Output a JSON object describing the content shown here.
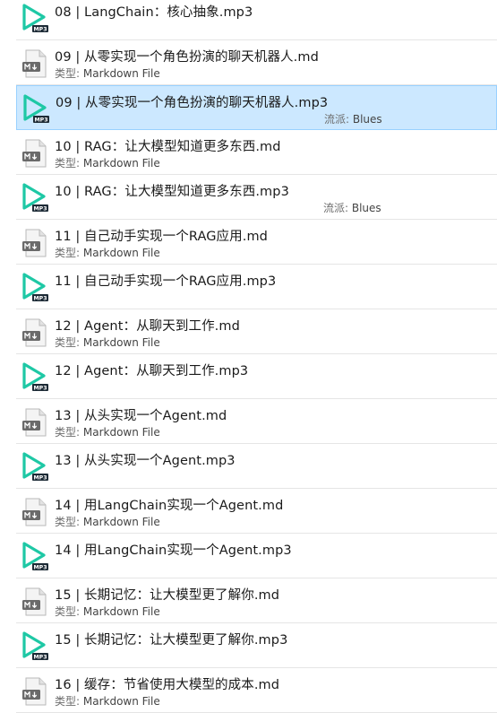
{
  "labels": {
    "type_prefix": "类型: ",
    "genre_prefix": "流派: "
  },
  "colors": {
    "mp3_play": "#1ec8a5",
    "selected_bg": "#cce8ff",
    "selected_border": "#99d1ff"
  },
  "files": [
    {
      "name": "08 | LangChain：核心抽象.mp3",
      "kind": "mp3",
      "icon": "mp3-play-icon",
      "type": "",
      "genre": ""
    },
    {
      "name": "09 | 从零实现一个角色扮演的聊天机器人.md",
      "kind": "md",
      "icon": "markdown-file-icon",
      "type": "Markdown File",
      "genre": ""
    },
    {
      "name": "09 | 从零实现一个角色扮演的聊天机器人.mp3",
      "kind": "mp3",
      "icon": "mp3-play-icon",
      "type": "",
      "genre": "Blues",
      "selected": true
    },
    {
      "name": "10 | RAG：让大模型知道更多东西.md",
      "kind": "md",
      "icon": "markdown-file-icon",
      "type": "Markdown File",
      "genre": ""
    },
    {
      "name": "10 | RAG：让大模型知道更多东西.mp3",
      "kind": "mp3",
      "icon": "mp3-play-icon",
      "type": "",
      "genre": "Blues"
    },
    {
      "name": "11 | 自己动手实现一个RAG应用.md",
      "kind": "md",
      "icon": "markdown-file-icon",
      "type": "Markdown File",
      "genre": ""
    },
    {
      "name": "11 | 自己动手实现一个RAG应用.mp3",
      "kind": "mp3",
      "icon": "mp3-play-icon",
      "type": "",
      "genre": ""
    },
    {
      "name": "12 | Agent：从聊天到工作.md",
      "kind": "md",
      "icon": "markdown-file-icon",
      "type": "Markdown File",
      "genre": ""
    },
    {
      "name": "12 | Agent：从聊天到工作.mp3",
      "kind": "mp3",
      "icon": "mp3-play-icon",
      "type": "",
      "genre": ""
    },
    {
      "name": "13 | 从头实现一个Agent.md",
      "kind": "md",
      "icon": "markdown-file-icon",
      "type": "Markdown File",
      "genre": ""
    },
    {
      "name": "13 | 从头实现一个Agent.mp3",
      "kind": "mp3",
      "icon": "mp3-play-icon",
      "type": "",
      "genre": ""
    },
    {
      "name": "14 | 用LangChain实现一个Agent.md",
      "kind": "md",
      "icon": "markdown-file-icon",
      "type": "Markdown File",
      "genre": ""
    },
    {
      "name": "14 | 用LangChain实现一个Agent.mp3",
      "kind": "mp3",
      "icon": "mp3-play-icon",
      "type": "",
      "genre": ""
    },
    {
      "name": "15 | 长期记忆：让大模型更了解你.md",
      "kind": "md",
      "icon": "markdown-file-icon",
      "type": "Markdown File",
      "genre": ""
    },
    {
      "name": "15 | 长期记忆：让大模型更了解你.mp3",
      "kind": "mp3",
      "icon": "mp3-play-icon",
      "type": "",
      "genre": ""
    },
    {
      "name": "16 | 缓存：节省使用大模型的成本.md",
      "kind": "md",
      "icon": "markdown-file-icon",
      "type": "Markdown File",
      "genre": ""
    }
  ]
}
